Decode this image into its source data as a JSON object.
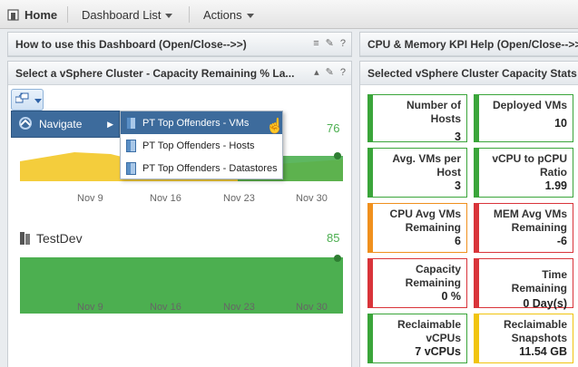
{
  "nav": {
    "home": "Home",
    "dashboard_list": "Dashboard List",
    "actions": "Actions"
  },
  "panels": {
    "how_to": "How to use this Dashboard (Open/Close-->>)",
    "kpi_help": "CPU & Memory KPI Help (Open/Close-->>)",
    "cluster_select": "Select a vSphere Cluster - Capacity Remaining % La...",
    "cluster_stats": "Selected vSphere Cluster Capacity Stats"
  },
  "menu": {
    "navigate": "Navigate",
    "items": [
      "PT Top Offenders - VMs",
      "PT Top Offenders - Hosts",
      "PT Top Offenders - Datastores"
    ]
  },
  "charts": [
    {
      "name": "",
      "value": "76",
      "x_ticks": [
        "Nov 9",
        "Nov 16",
        "Nov 23",
        "Nov 30"
      ]
    },
    {
      "name": "TestDev",
      "value": "85",
      "x_ticks": [
        "Nov 9",
        "Nov 16",
        "Nov 23",
        "Nov 30"
      ]
    }
  ],
  "tiles": [
    {
      "label": "Number of Hosts",
      "value": "3",
      "status": "green"
    },
    {
      "label": "Deployed VMs",
      "value": "10",
      "status": "green"
    },
    {
      "label": "Avg. VMs per Host",
      "value": "3",
      "status": "green"
    },
    {
      "label": "vCPU to pCPU Ratio",
      "value": "1.99",
      "status": "green"
    },
    {
      "label": "CPU Avg VMs Remaining",
      "value": "6",
      "status": "orange"
    },
    {
      "label": "MEM Avg VMs Remaining",
      "value": "-6",
      "status": "red"
    },
    {
      "label": "Capacity Remaining",
      "value": "0 %",
      "status": "red"
    },
    {
      "label": "Time Remaining",
      "value": "0 Day(s)",
      "status": "red"
    },
    {
      "label": "Reclaimable vCPUs",
      "value": "7 vCPUs",
      "status": "green"
    },
    {
      "label": "Reclaimable Snapshots",
      "value": "11.54 GB",
      "status": "yellow"
    }
  ],
  "colors": {
    "green": "#3aa53a",
    "orange": "#f0901e",
    "red": "#d9343a",
    "yellow": "#f1c40f",
    "menu_blue": "#3d6b9c"
  }
}
